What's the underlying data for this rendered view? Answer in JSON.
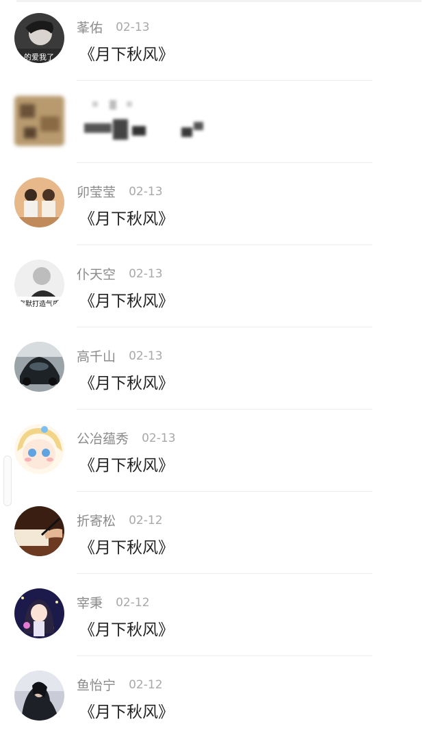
{
  "list": {
    "items": [
      {
        "name": "莑佑",
        "time": "02-13",
        "message": "《月下秋风》",
        "avatar_icon": "avatar-photo-boy-icon"
      },
      {
        "name": "",
        "time": "",
        "message": "",
        "avatar_icon": "avatar-blurred-icon"
      },
      {
        "name": "卯莹莹",
        "time": "02-13",
        "message": "《月下秋风》",
        "avatar_icon": "avatar-couple-photo-icon"
      },
      {
        "name": "仆天空",
        "time": "02-13",
        "message": "《月下秋风》",
        "avatar_icon": "avatar-bw-portrait-icon"
      },
      {
        "name": "高千山",
        "time": "02-13",
        "message": "《月下秋风》",
        "avatar_icon": "avatar-car-icon"
      },
      {
        "name": "公冶蕴秀",
        "time": "02-13",
        "message": "《月下秋风》",
        "avatar_icon": "avatar-anime-blonde-icon"
      },
      {
        "name": "折寄松",
        "time": "02-12",
        "message": "《月下秋风》",
        "avatar_icon": "avatar-writing-hand-icon"
      },
      {
        "name": "宰秉",
        "time": "02-12",
        "message": "《月下秋风》",
        "avatar_icon": "avatar-anime-girl-icon"
      },
      {
        "name": "鱼怡宁",
        "time": "02-12",
        "message": "《月下秋风》",
        "avatar_icon": "avatar-hugging-couple-icon"
      }
    ]
  },
  "avatar_captions": {
    "first": "的爱我了",
    "fourth": "究默打造气质"
  },
  "colors": {
    "name": "#8a8a8a",
    "time": "#a8a8a8",
    "message": "#222222",
    "divider": "#eeeeee",
    "background": "#ffffff"
  }
}
